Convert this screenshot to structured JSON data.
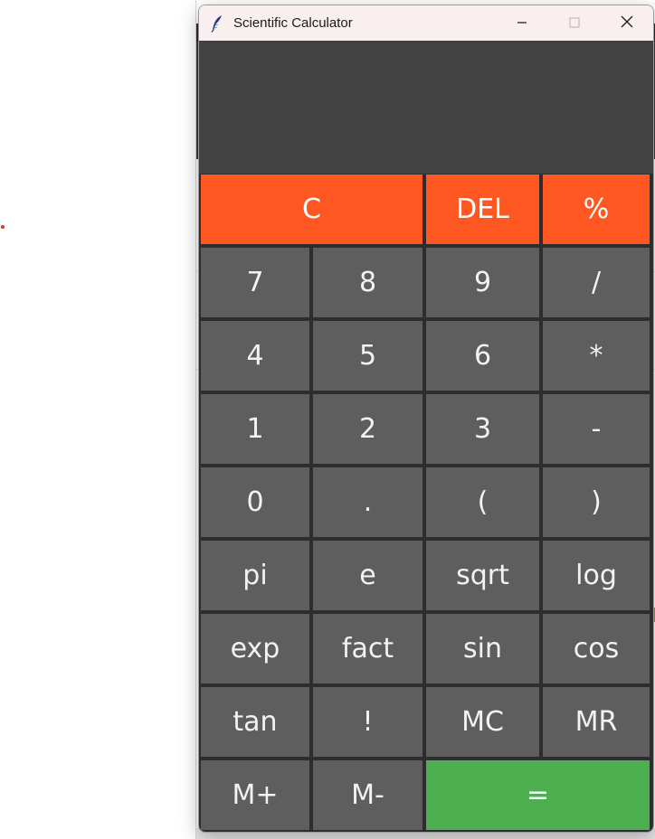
{
  "window": {
    "title": "Scientific Calculator",
    "app_icon": "feather-icon",
    "controls": [
      "minimize-icon",
      "maximize-icon",
      "close-icon"
    ]
  },
  "display": {
    "value": ""
  },
  "keys": {
    "row1": [
      "C",
      "DEL",
      "%"
    ],
    "row2": [
      "7",
      "8",
      "9",
      "/"
    ],
    "row3": [
      "4",
      "5",
      "6",
      "*"
    ],
    "row4": [
      "1",
      "2",
      "3",
      "-"
    ],
    "row5": [
      "0",
      ".",
      "(",
      ")"
    ],
    "row6": [
      "pi",
      "e",
      "sqrt",
      "log"
    ],
    "row7": [
      "exp",
      "fact",
      "sin",
      "cos"
    ],
    "row8": [
      "tan",
      "!",
      "MC",
      "MR"
    ],
    "row9": [
      "M+",
      "M-",
      "="
    ]
  },
  "colors": {
    "display_bg": "#424242",
    "key_bg": "#5e5e5e",
    "accent_orange": "#ff5722",
    "accent_green": "#4caf50",
    "titlebar_bg": "#f9efee"
  }
}
